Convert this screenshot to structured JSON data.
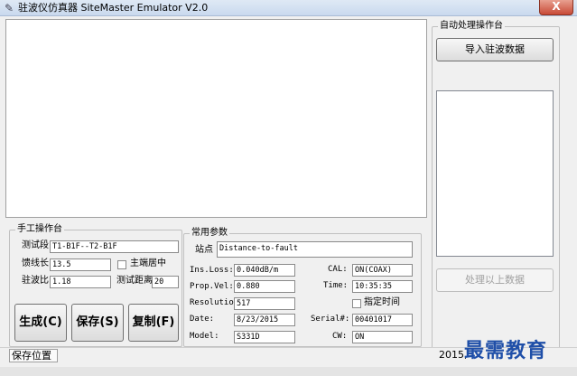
{
  "window": {
    "title": "驻波仪仿真器 SiteMaster Emulator V2.0",
    "close_symbol": "X"
  },
  "auto": {
    "title": "自动处理操作台",
    "import_label": "导入驻波数据",
    "process_label": "处理以上数据"
  },
  "manual": {
    "title": "手工操作台",
    "segment_label": "测试段",
    "segment_value": "T1-B1F--T2-B1F",
    "cable_label": "馈线长",
    "cable_value": "13.5",
    "main_shaft_label": "主端居中",
    "vswr_label": "驻波比",
    "vswr_value": "1.18",
    "distance_label": "测试距离",
    "distance_value": "20",
    "generate_label": "生成(C)",
    "save_label": "保存(S)",
    "copy_label": "复制(F)"
  },
  "common": {
    "title": "常用参数",
    "site_label": "站点",
    "site_value": "Distance-to-fault",
    "ins_loss_label": "Ins.Loss:",
    "ins_loss_value": "0.040dB/m",
    "cal_label": "CAL:",
    "cal_value": "ON(COAX)",
    "prop_vel_label": "Prop.Vel:",
    "prop_vel_value": "0.880",
    "time_label": "Time:",
    "time_value": "10:35:35",
    "resolution_label": "Resolution:",
    "resolution_value": "517",
    "specify_time_label": "指定时间",
    "date_label": "Date:",
    "date_value": "8/23/2015",
    "serial_label": "Serial#:",
    "serial_value": "00401017",
    "model_label": "Model:",
    "model_value": "S331D",
    "cw_label": "CW:",
    "cw_value": "ON"
  },
  "status": {
    "save_location": "保存位置",
    "date_partial": "2015,",
    "watermark": "最需教育"
  }
}
